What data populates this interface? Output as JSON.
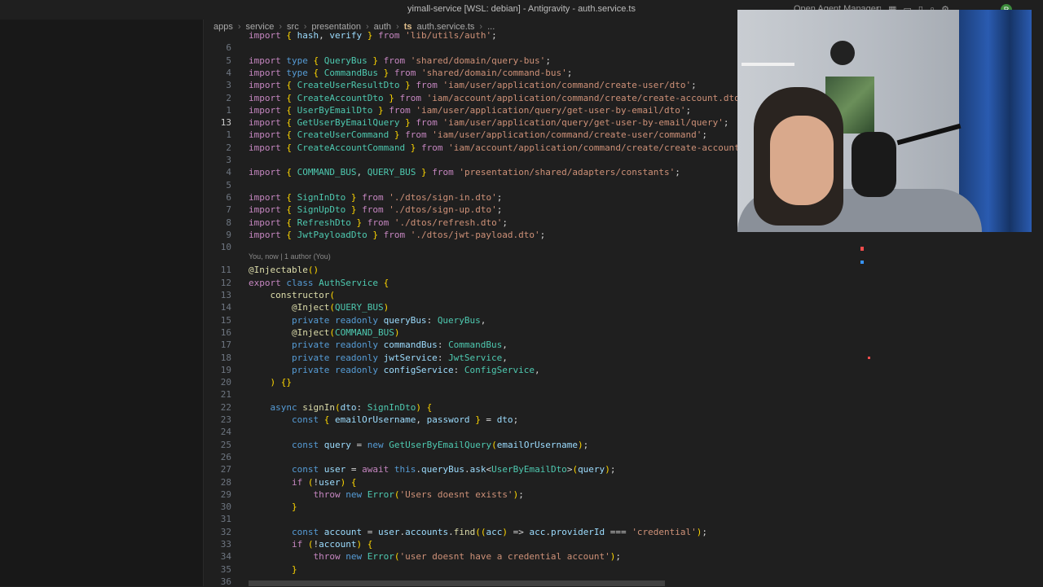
{
  "window": {
    "title": "yimall-service [WSL: debian] - Antigravity - auth.service.ts",
    "agent_manager": "Open Agent Manager"
  },
  "titlebar_icons": [
    "panel-left-icon",
    "layout-icon",
    "panel-bottom-icon",
    "panel-right-icon",
    "search-icon",
    "settings-icon",
    "account-icon"
  ],
  "avatar_letter": "R",
  "breadcrumb": [
    "apps",
    "service",
    "src",
    "presentation",
    "auth",
    "auth.service.ts",
    "..."
  ],
  "codelens": "You, now | 1 author (You)",
  "lines": [
    {
      "n": "",
      "code": "import { hash, verify } from 'lib/utils/auth';"
    },
    {
      "n": "6",
      "code": ""
    },
    {
      "n": "5",
      "code": "import type { QueryBus } from 'shared/domain/query-bus';"
    },
    {
      "n": "4",
      "code": "import type { CommandBus } from 'shared/domain/command-bus';"
    },
    {
      "n": "3",
      "code": "import { CreateUserResultDto } from 'iam/user/application/command/create-user/dto';"
    },
    {
      "n": "2",
      "code": "import { CreateAccountDto } from 'iam/account/application/command/create/create-account.dto';"
    },
    {
      "n": "1",
      "code": "import { UserByEmailDto } from 'iam/user/application/query/get-user-by-email/dto';"
    },
    {
      "n": "13",
      "code": "import { GetUserByEmailQuery } from 'iam/user/application/query/get-user-by-email/query';"
    },
    {
      "n": "1",
      "code": "import { CreateUserCommand } from 'iam/user/application/command/create-user/command';"
    },
    {
      "n": "2",
      "code": "import { CreateAccountCommand } from 'iam/account/application/command/create/create-account.command';"
    },
    {
      "n": "3",
      "code": ""
    },
    {
      "n": "4",
      "code": "import { COMMAND_BUS, QUERY_BUS } from 'presentation/shared/adapters/constants';"
    },
    {
      "n": "5",
      "code": ""
    },
    {
      "n": "6",
      "code": "import { SignInDto } from './dtos/sign-in.dto';"
    },
    {
      "n": "7",
      "code": "import { SignUpDto } from './dtos/sign-up.dto';"
    },
    {
      "n": "8",
      "code": "import { RefreshDto } from './dtos/refresh.dto';"
    },
    {
      "n": "9",
      "code": "import { JwtPayloadDto } from './dtos/jwt-payload.dto';"
    },
    {
      "n": "10",
      "code": ""
    },
    {
      "n": "11",
      "code": "@Injectable()"
    },
    {
      "n": "12",
      "code": "export class AuthService {"
    },
    {
      "n": "13",
      "code": "    constructor("
    },
    {
      "n": "14",
      "code": "        @Inject(QUERY_BUS)"
    },
    {
      "n": "15",
      "code": "        private readonly queryBus: QueryBus,"
    },
    {
      "n": "16",
      "code": "        @Inject(COMMAND_BUS)"
    },
    {
      "n": "17",
      "code": "        private readonly commandBus: CommandBus,"
    },
    {
      "n": "18",
      "code": "        private readonly jwtService: JwtService,"
    },
    {
      "n": "19",
      "code": "        private readonly configService: ConfigService,"
    },
    {
      "n": "20",
      "code": "    ) {}"
    },
    {
      "n": "21",
      "code": ""
    },
    {
      "n": "22",
      "code": "    async signIn(dto: SignInDto) {"
    },
    {
      "n": "23",
      "code": "        const { emailOrUsername, password } = dto;"
    },
    {
      "n": "24",
      "code": ""
    },
    {
      "n": "25",
      "code": "        const query = new GetUserByEmailQuery(emailOrUsername);"
    },
    {
      "n": "26",
      "code": ""
    },
    {
      "n": "27",
      "code": "        const user = await this.queryBus.ask<UserByEmailDto>(query);"
    },
    {
      "n": "28",
      "code": "        if (!user) {"
    },
    {
      "n": "29",
      "code": "            throw new Error('Users doesnt exists');"
    },
    {
      "n": "30",
      "code": "        }"
    },
    {
      "n": "31",
      "code": ""
    },
    {
      "n": "32",
      "code": "        const account = user.accounts.find((acc) => acc.providerId === 'credential');"
    },
    {
      "n": "33",
      "code": "        if (!account) {"
    },
    {
      "n": "34",
      "code": "            throw new Error('user doesnt have a credential account');"
    },
    {
      "n": "35",
      "code": "        }"
    },
    {
      "n": "36",
      "code": ""
    }
  ]
}
